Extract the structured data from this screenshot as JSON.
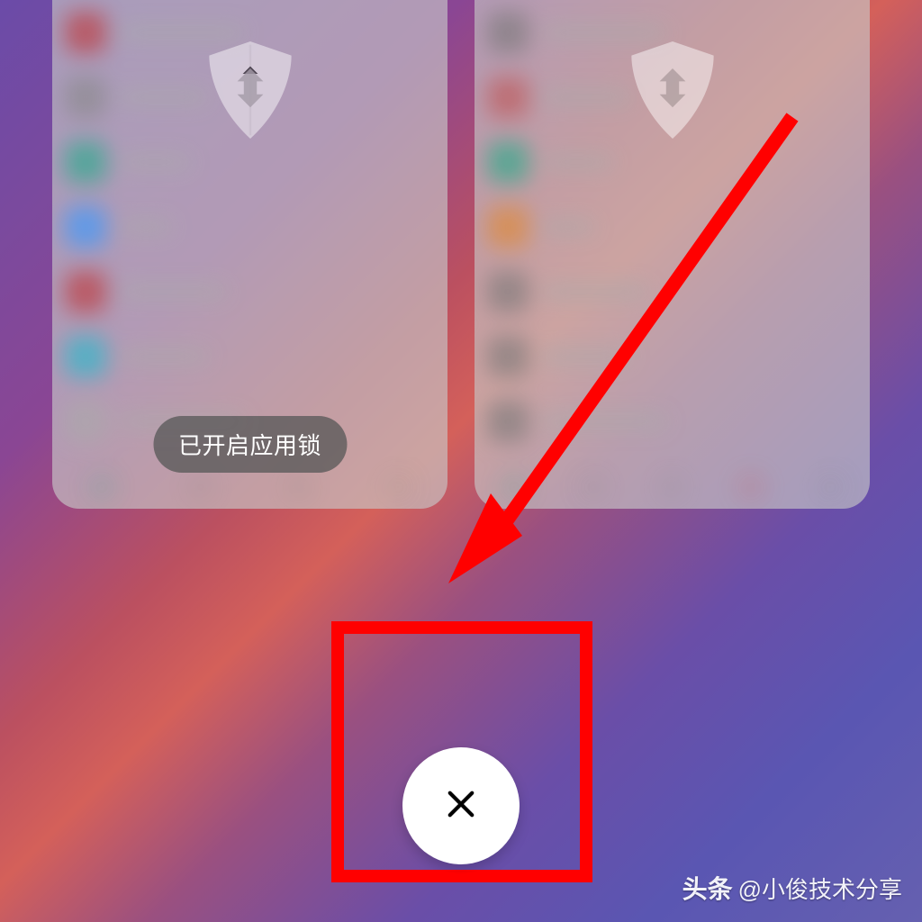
{
  "recents": {
    "cards": [
      {
        "locked": true,
        "pill_label": "已开启应用锁"
      },
      {
        "locked": true,
        "pill_label": ""
      }
    ]
  },
  "close_button": {
    "icon_name": "close-icon"
  },
  "annotation": {
    "highlight_color": "#ff0000",
    "arrow_color": "#ff0000"
  },
  "watermark": {
    "brand": "头条",
    "handle": "@小俊技术分享"
  }
}
